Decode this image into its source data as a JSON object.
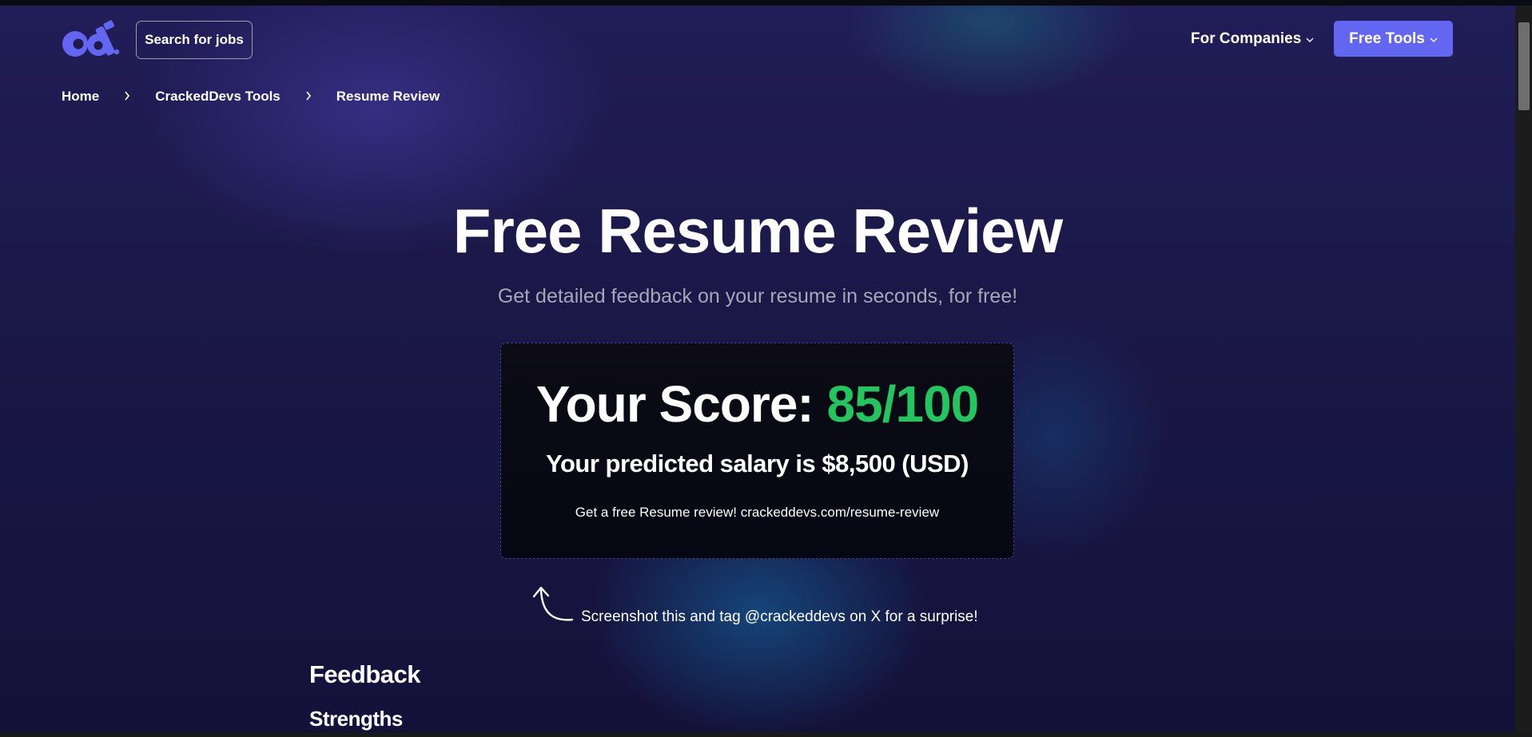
{
  "header": {
    "search_jobs_label": "Search for jobs",
    "for_companies_label": "For Companies",
    "free_tools_label": "Free Tools",
    "chevron_glyph": "⌄"
  },
  "breadcrumb": {
    "items": [
      {
        "label": "Home"
      },
      {
        "label": "CrackedDevs Tools"
      },
      {
        "label": "Resume Review"
      }
    ],
    "separator": "›"
  },
  "hero": {
    "title": "Free Resume Review",
    "subtitle": "Get detailed feedback on your resume in seconds, for free!"
  },
  "score_card": {
    "score_prefix": "Your Score:",
    "score_value": "85/100",
    "salary_text": "Your predicted salary is $8,500 (USD)",
    "promo_text": "Get a free Resume review! crackeddevs.com/resume-review"
  },
  "hint": {
    "text": "Screenshot this and tag @crackeddevs on X for a surprise!"
  },
  "feedback": {
    "heading": "Feedback",
    "strengths_heading": "Strengths"
  },
  "colors": {
    "accent": "#6366f1",
    "score_green": "#22c55e",
    "background": "#1b1848"
  },
  "icons": {
    "logo": "crackeddevs-logo",
    "arrow": "curved-arrow-up-icon"
  }
}
